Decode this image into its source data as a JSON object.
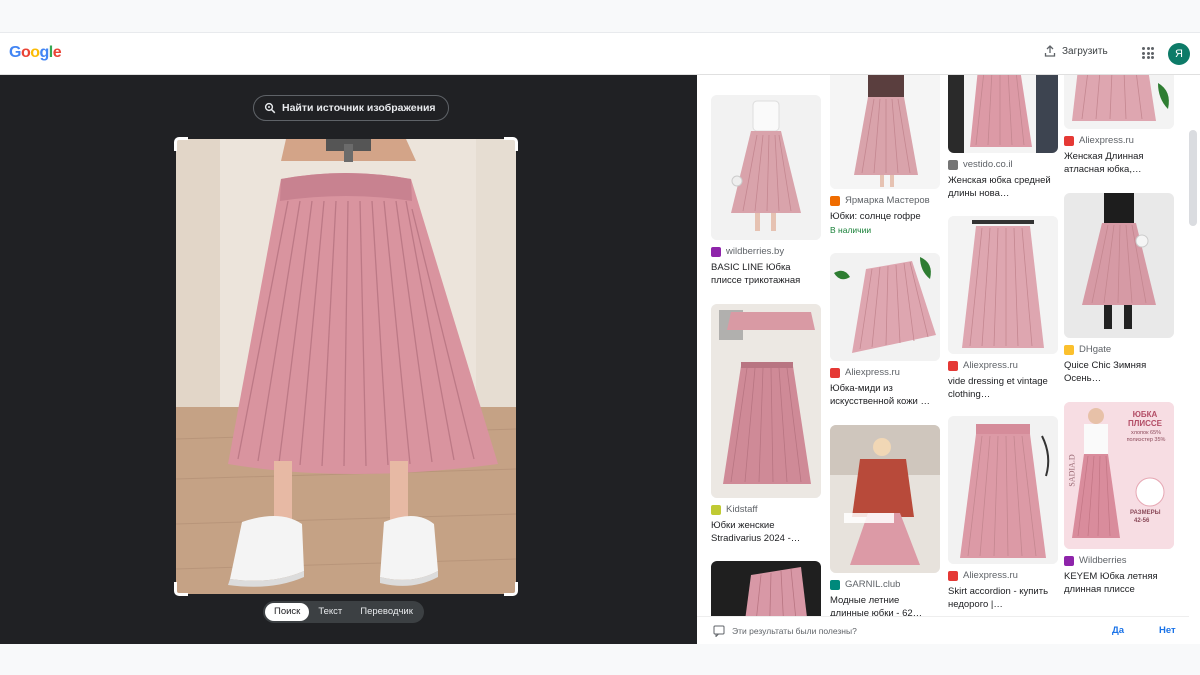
{
  "header": {
    "upload_label": "Загрузить",
    "avatar_letter": "Я"
  },
  "logo_letters": [
    {
      "ch": "G",
      "color": "#4285f4"
    },
    {
      "ch": "o",
      "color": "#ea4335"
    },
    {
      "ch": "o",
      "color": "#fbbc05"
    },
    {
      "ch": "g",
      "color": "#4285f4"
    },
    {
      "ch": "l",
      "color": "#34a853"
    },
    {
      "ch": "e",
      "color": "#ea4335"
    }
  ],
  "lens": {
    "find_source_label": "Найти источник изображения",
    "modes": [
      {
        "label": "Поиск",
        "active": true
      },
      {
        "label": "Текст",
        "active": false
      },
      {
        "label": "Переводчик",
        "active": false
      }
    ]
  },
  "results": {
    "col1": [
      {
        "source": "wildberries.by",
        "fav": "#8e24aa",
        "title": "BASIC LINE Юбка плиссе трикотажная",
        "stock": ""
      },
      {
        "source": "Kidstaff",
        "fav": "#c0ca33",
        "title": "Юбки женские Stradivarius 2024 -…",
        "stock": ""
      }
    ],
    "col2": [
      {
        "source": "Ярмарка Мастеров",
        "fav": "#ef6c00",
        "title": "Юбки: солнце гофре",
        "stock": "В наличии"
      },
      {
        "source": "Aliexpress.ru",
        "fav": "#e53935",
        "title": "Юбка-миди из искусственной кожи …",
        "stock": ""
      },
      {
        "source": "GARNIL.club",
        "fav": "#00897b",
        "title": "Модные летние длинные юбки - 62…",
        "stock": ""
      }
    ],
    "col3": [
      {
        "source": "vestido.co.il",
        "fav": "#757575",
        "title": "Женская юбка средней длины нова…",
        "stock": ""
      },
      {
        "source": "Aliexpress.ru",
        "fav": "#e53935",
        "title": "vide dressing et vintage clothing…",
        "stock": ""
      },
      {
        "source": "Aliexpress.ru",
        "fav": "#e53935",
        "title": "Skirt accordion - купить недорого |…",
        "stock": ""
      }
    ],
    "col4": [
      {
        "source": "Aliexpress.ru",
        "fav": "#e53935",
        "title": "Женская Длинная атласная юбка,…",
        "stock": ""
      },
      {
        "source": "DHgate",
        "fav": "#fbc02d",
        "title": "Quice Chic Зимняя Осень…",
        "stock": ""
      },
      {
        "source": "Wildberries",
        "fav": "#8e24aa",
        "title": "KEYEM Юбка летняя длинная плиссе",
        "stock": ""
      }
    ],
    "promo": {
      "headline": "ЮБКА ПЛИССЕ",
      "fabric": "хлопок 65% полиэстер 35%",
      "sizes_label": "РАЗМЕРЫ",
      "sizes": "42-56",
      "brand": "SADIA.D"
    }
  },
  "feedback": {
    "question": "Эти результаты были полезны?",
    "yes": "Да",
    "no": "Нет"
  },
  "colors": {
    "skirt_pink": "#d9949f",
    "panel_dark": "#202124",
    "link_blue": "#1a73e8"
  }
}
